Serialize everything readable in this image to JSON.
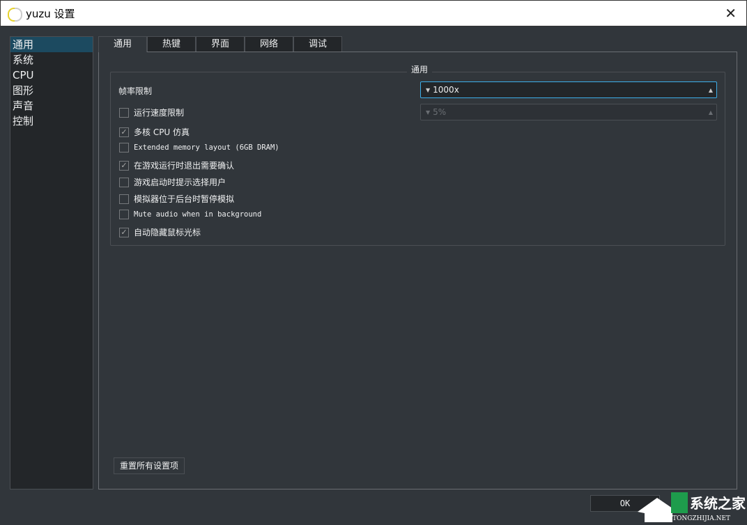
{
  "window": {
    "title": "yuzu 设置"
  },
  "sidebar": {
    "items": [
      {
        "label": "通用"
      },
      {
        "label": "系统"
      },
      {
        "label": "CPU"
      },
      {
        "label": "图形"
      },
      {
        "label": "声音"
      },
      {
        "label": "控制"
      }
    ]
  },
  "tabs": [
    {
      "label": "通用"
    },
    {
      "label": "热键"
    },
    {
      "label": "界面"
    },
    {
      "label": "网络"
    },
    {
      "label": "调试"
    }
  ],
  "group": {
    "title": "通用"
  },
  "frame_limit": {
    "label": "帧率限制",
    "value": "1000x"
  },
  "speed_limit": {
    "value": "5%"
  },
  "checkboxes": [
    {
      "label": "运行速度限制",
      "checked": false
    },
    {
      "label": "多核 CPU 仿真",
      "checked": true
    },
    {
      "label": "Extended memory layout (6GB DRAM)",
      "checked": false
    },
    {
      "label": "在游戏运行时退出需要确认",
      "checked": true
    },
    {
      "label": "游戏启动时提示选择用户",
      "checked": false
    },
    {
      "label": "模拟器位于后台时暂停模拟",
      "checked": false
    },
    {
      "label": "Mute audio when in background",
      "checked": false
    },
    {
      "label": "自动隐藏鼠标光标",
      "checked": true
    }
  ],
  "buttons": {
    "reset": "重置所有设置项",
    "ok": "OK"
  },
  "watermark": {
    "text": "系统之家",
    "url": "XITONGZHIJIA.NET"
  }
}
